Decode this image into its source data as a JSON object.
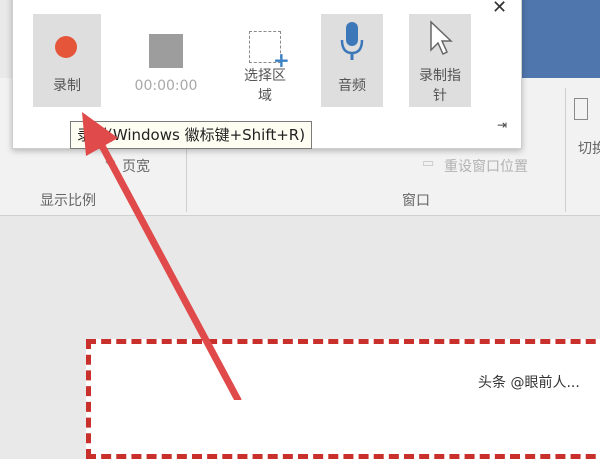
{
  "toolbar": {
    "record_label": "录制",
    "timer": "00:00:00",
    "select_area_label_line1": "选择区",
    "select_area_label_line2": "域",
    "audio_label": "音频",
    "record_pointer_label_line1": "录制指",
    "record_pointer_label_line2": "针"
  },
  "tooltip": {
    "text": "录制(Windows 徽标键+Shift+R)"
  },
  "ribbon": {
    "page_width": "页宽",
    "zoom_group_label": "显示比例",
    "reset_window_position": "重设窗口位置",
    "window_group_label": "窗口",
    "switch_label": "切换"
  },
  "watermark": {
    "text": "头条 @眼前人..."
  },
  "colors": {
    "record_dot": "#e5553a",
    "select_plus": "#3a82c4",
    "microphone": "#3c78b9",
    "arrow": "#e04a4a",
    "dashed_border": "#c9302c",
    "titlebar": "#4f76ad"
  }
}
